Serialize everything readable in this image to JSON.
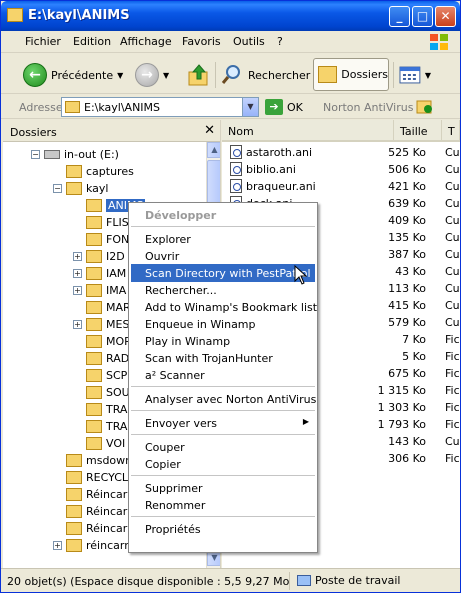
{
  "window": {
    "title": "E:\\kayl\\ANIMS"
  },
  "title_buttons": {
    "minimize": "_",
    "maximize": "□",
    "close": "✕"
  },
  "menubar": {
    "items": [
      "Fichier",
      "Edition",
      "Affichage",
      "Favoris",
      "Outils",
      "?"
    ]
  },
  "toolbar": {
    "back_label": "Précédente",
    "search_label": "Rechercher",
    "folders_label": "Dossiers"
  },
  "address": {
    "label": "Adresse",
    "value": "E:\\kayl\\ANIMS",
    "ok_label": "OK",
    "norton_label": "Norton AntiVirus"
  },
  "folders_pane": {
    "title": "Dossiers",
    "tree": [
      {
        "label": "in-out (E:)",
        "icon": "drive",
        "expander": "−"
      },
      {
        "label": "captures",
        "icon": "folder",
        "expander": ""
      },
      {
        "label": "kayl",
        "icon": "folder",
        "expander": "−"
      },
      {
        "label": "ANIMS",
        "icon": "folder",
        "expander": "",
        "selected": true
      },
      {
        "label": "FLIS",
        "icon": "folder",
        "expander": ""
      },
      {
        "label": "FON",
        "icon": "folder",
        "expander": ""
      },
      {
        "label": "I2D",
        "icon": "folder",
        "expander": "+"
      },
      {
        "label": "IAM",
        "icon": "folder",
        "expander": "+"
      },
      {
        "label": "IMA",
        "icon": "folder",
        "expander": "+"
      },
      {
        "label": "MAR",
        "icon": "folder",
        "expander": ""
      },
      {
        "label": "MES",
        "icon": "folder",
        "expander": "+"
      },
      {
        "label": "MOR",
        "icon": "folder",
        "expander": ""
      },
      {
        "label": "RAD",
        "icon": "folder",
        "expander": ""
      },
      {
        "label": "SCP",
        "icon": "folder",
        "expander": ""
      },
      {
        "label": "SOU",
        "icon": "folder",
        "expander": ""
      },
      {
        "label": "TRA",
        "icon": "folder",
        "expander": ""
      },
      {
        "label": "TRA",
        "icon": "folder",
        "expander": ""
      },
      {
        "label": "VOI",
        "icon": "folder",
        "expander": ""
      },
      {
        "label": "msdown",
        "icon": "folder",
        "expander": ""
      },
      {
        "label": "RECYCL",
        "icon": "folder",
        "expander": ""
      },
      {
        "label": "Réincarn",
        "icon": "folder",
        "expander": ""
      },
      {
        "label": "Réincarn",
        "icon": "folder",
        "expander": ""
      },
      {
        "label": "Réincarn",
        "icon": "folder",
        "expander": ""
      },
      {
        "label": "réincarn",
        "icon": "folder",
        "expander": "+"
      }
    ]
  },
  "files_pane": {
    "columns": {
      "name": "Nom",
      "size": "Taille",
      "type": "T"
    },
    "rows": [
      {
        "name": "astaroth.ani",
        "size": "525 Ko",
        "type": "Cu"
      },
      {
        "name": "biblio.ani",
        "size": "506 Ko",
        "type": "Cu"
      },
      {
        "name": "braqueur.ani",
        "size": "421 Ko",
        "type": "Cu"
      },
      {
        "name": "dock.ani",
        "size": "639 Ko",
        "type": "Cu"
      },
      {
        "name": "",
        "size": "409 Ko",
        "type": "Cu"
      },
      {
        "name": "",
        "size": "135 Ko",
        "type": "Cu"
      },
      {
        "name": "",
        "size": "387 Ko",
        "type": "Cu"
      },
      {
        "name": "",
        "size": "43 Ko",
        "type": "Cu"
      },
      {
        "name": "",
        "size": "113 Ko",
        "type": "Cu"
      },
      {
        "name": "",
        "size": "415 Ko",
        "type": "Cu"
      },
      {
        "name": "",
        "size": "579 Ko",
        "type": "Cu"
      },
      {
        "name": "",
        "size": "7 Ko",
        "type": "Fic"
      },
      {
        "name": "",
        "size": "5 Ko",
        "type": "Fic"
      },
      {
        "name": "",
        "size": "675 Ko",
        "type": "Fic"
      },
      {
        "name": "",
        "size": "1 315 Ko",
        "type": "Fic"
      },
      {
        "name": "",
        "size": "1 303 Ko",
        "type": "Fic"
      },
      {
        "name": "",
        "size": "1 793 Ko",
        "type": "Fic"
      },
      {
        "name": "",
        "size": "143 Ko",
        "type": "Cu"
      },
      {
        "name": "",
        "size": "306 Ko",
        "type": "Fic"
      }
    ]
  },
  "context_menu": {
    "items": [
      {
        "label": "Développer",
        "kind": "disabled"
      },
      {
        "kind": "sep"
      },
      {
        "label": "Explorer",
        "kind": "item"
      },
      {
        "label": "Ouvrir",
        "kind": "item"
      },
      {
        "label": "Scan Directory with PestPatrol",
        "kind": "hover"
      },
      {
        "label": "Rechercher...",
        "kind": "item"
      },
      {
        "label": "Add to Winamp's Bookmark list",
        "kind": "item"
      },
      {
        "label": "Enqueue in Winamp",
        "kind": "item"
      },
      {
        "label": "Play in Winamp",
        "kind": "item"
      },
      {
        "label": "Scan with TrojanHunter",
        "kind": "item"
      },
      {
        "label": "a² Scanner",
        "kind": "item"
      },
      {
        "kind": "sep"
      },
      {
        "label": "Analyser avec Norton AntiVirus",
        "kind": "item"
      },
      {
        "kind": "sep"
      },
      {
        "label": "Envoyer vers",
        "kind": "submenu"
      },
      {
        "kind": "sep"
      },
      {
        "label": "Couper",
        "kind": "item"
      },
      {
        "label": "Copier",
        "kind": "item"
      },
      {
        "kind": "sep"
      },
      {
        "label": "Supprimer",
        "kind": "item"
      },
      {
        "label": "Renommer",
        "kind": "item"
      },
      {
        "kind": "sep"
      },
      {
        "label": "Propriétés",
        "kind": "item"
      }
    ]
  },
  "statusbar": {
    "text": "20 objet(s) (Espace disque disponible : 5,5  9,27 Mo",
    "location": "Poste de travail"
  },
  "colors": {
    "title_blue": "#0a58e6",
    "selection": "#316ac5",
    "chrome": "#ece9d8"
  }
}
